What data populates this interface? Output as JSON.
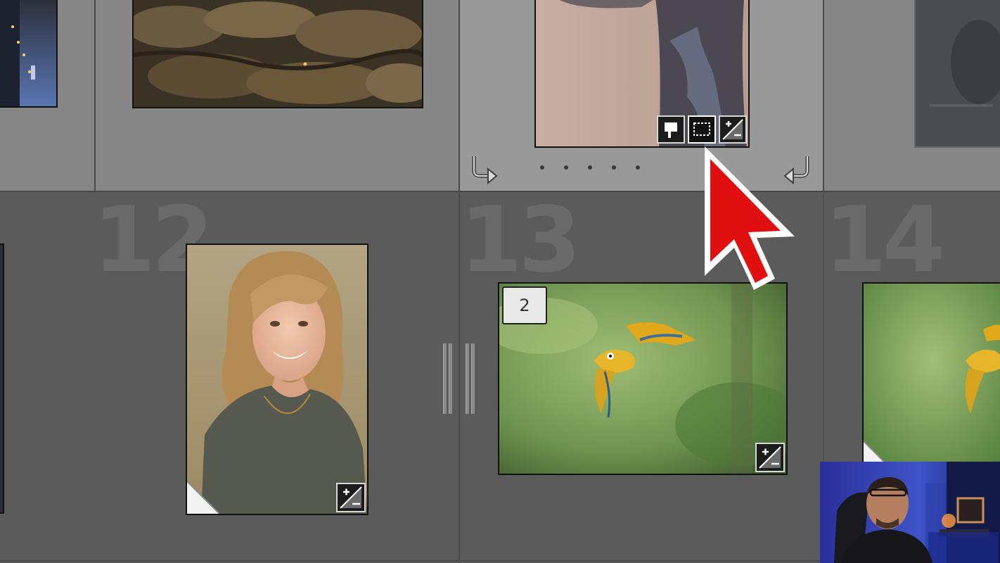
{
  "grid": {
    "cells": [
      {
        "index_label": ""
      },
      {
        "index_label": ""
      },
      {
        "index_label": ""
      },
      {
        "index_label": ""
      },
      {
        "index_label": ""
      },
      {
        "index_label": "12"
      },
      {
        "index_label": "13"
      },
      {
        "index_label": "14"
      }
    ],
    "stack_count": "2"
  },
  "icons": {
    "flag": "flag-icon",
    "crop": "crop-icon",
    "exposure": "exposure-adjustment-icon",
    "stack_left": "stack-collapse-left-icon",
    "stack_right": "stack-collapse-right-icon",
    "cursor": "mouse-pointer-icon",
    "virtual_copy": "virtual-copy-corner-icon",
    "grip": "stack-grip-icon"
  },
  "colors": {
    "cursor": "#e01010",
    "selected_cell": "#999999",
    "grid_bg": "#5b5b5b"
  }
}
